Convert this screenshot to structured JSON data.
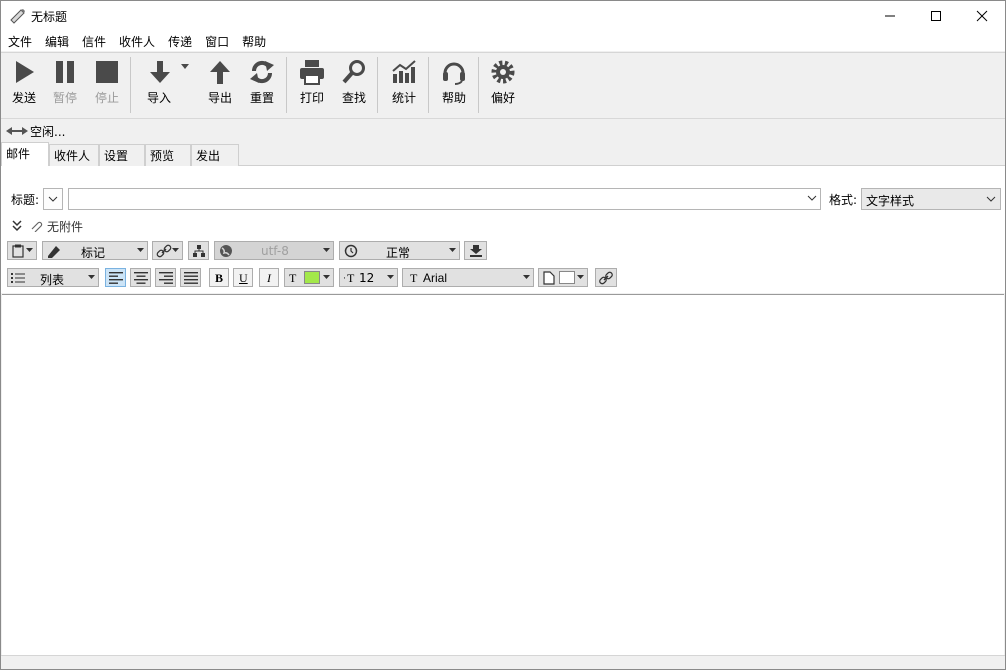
{
  "window": {
    "title": "无标题"
  },
  "menu": [
    "文件",
    "编辑",
    "信件",
    "收件人",
    "传递",
    "窗口",
    "帮助"
  ],
  "toolbar": {
    "send": "发送",
    "pause": "暂停",
    "stop": "停止",
    "import": "导入",
    "export": "导出",
    "reset": "重置",
    "print": "打印",
    "find": "查找",
    "stats": "统计",
    "help": "帮助",
    "prefs": "偏好"
  },
  "status": {
    "text": "空闲..."
  },
  "tabs": [
    "邮件",
    "收件人",
    "设置",
    "预览",
    "发出"
  ],
  "form": {
    "subject_label": "标题:",
    "subject_value": "",
    "format_label": "格式:",
    "format_value": "文字样式",
    "attachments": "无附件"
  },
  "format_bar": {
    "mark": "标记",
    "encoding": "utf-8",
    "priority": "正常",
    "list": "列表",
    "bold": "B",
    "underline": "U",
    "italic": "I",
    "text_color_glyph": "T",
    "font_size": "12",
    "font_size_glyph": "T",
    "font_name": "Arial",
    "font_name_glyph": "T",
    "text_color_hex": "#a3e84a"
  },
  "colors": {
    "toolbar_icon": "#4a4a4a",
    "window_bg": "#f0f0f0"
  }
}
